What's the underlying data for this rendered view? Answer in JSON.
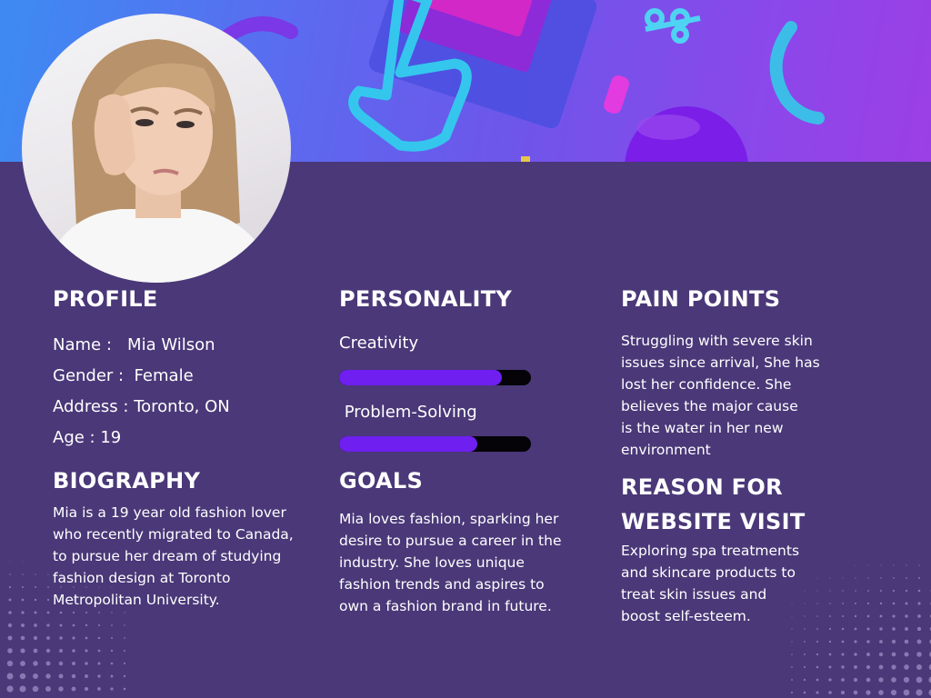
{
  "profile": {
    "heading": "PROFILE",
    "name_line": "Name :   Mia Wilson",
    "gender_line": "Gender :  Female",
    "address_line": "Address : Toronto, ON",
    "age_line": "Age : 19"
  },
  "biography": {
    "heading": "BIOGRAPHY",
    "text": "Mia is a 19 year old fashion lover\nwho recently migrated to Canada,\nto pursue her dream of studying\nfashion design at Toronto\nMetropolitan University."
  },
  "personality": {
    "heading": "PERSONALITY",
    "traits": [
      {
        "label": "Creativity",
        "level": 0.85
      },
      {
        "label": " Problem-Solving",
        "level": 0.72
      }
    ]
  },
  "goals": {
    "heading": "GOALS",
    "text": "Mia loves fashion, sparking her\ndesire to pursue a career in the\nindustry.  She loves unique\nfashion trends and aspires to\nown a fashion brand in future."
  },
  "pain_points": {
    "heading": "PAIN POINTS",
    "text": "Struggling with severe skin\nissues since arrival, She has\nlost her confidence. She\nbelieves the major cause\n is the water in her new\nenvironment"
  },
  "reason": {
    "heading_line1": "REASON FOR",
    "heading_line2": "WEBSITE VISIT",
    "text": "Exploring spa treatments\nand skincare products to\ntreat skin issues and\nboost self-esteem."
  },
  "colors": {
    "background": "#4a3878",
    "bar_fill": "#6f1ff0",
    "bar_track": "#050308"
  },
  "icons": {
    "banner": "pointer-hand-3d-icon",
    "avatar": "profile-photo"
  }
}
